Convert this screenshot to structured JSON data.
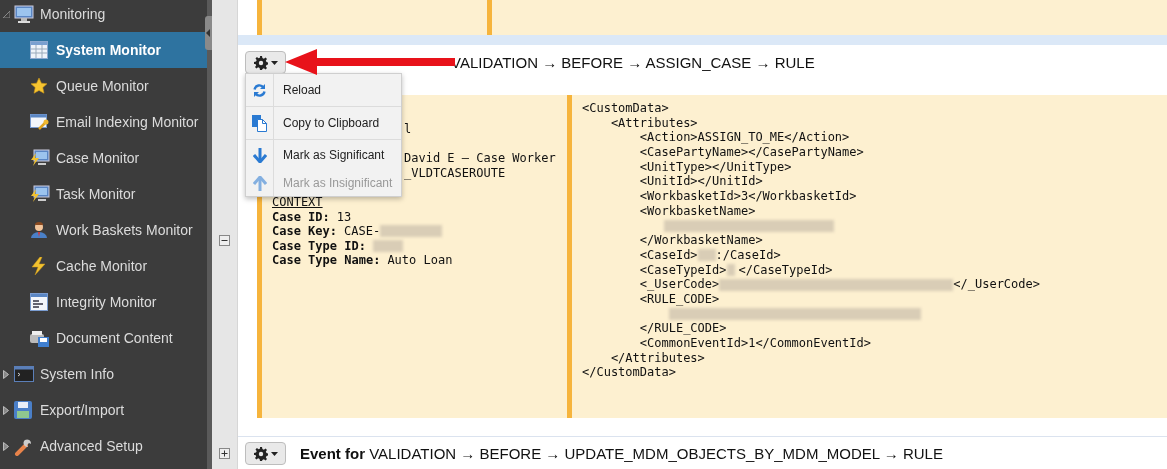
{
  "sidebar": {
    "items": [
      {
        "label": "Monitoring",
        "expanded": true,
        "selected": false,
        "children": [
          {
            "label": "System Monitor",
            "selected": true
          },
          {
            "label": "Queue Monitor",
            "selected": false
          },
          {
            "label": "Email Indexing Monitor",
            "selected": false
          },
          {
            "label": "Case Monitor",
            "selected": false
          },
          {
            "label": "Task Monitor",
            "selected": false
          },
          {
            "label": "Work Baskets Monitor",
            "selected": false
          },
          {
            "label": "Cache Monitor",
            "selected": false
          },
          {
            "label": "Integrity Monitor",
            "selected": false
          },
          {
            "label": "Document Content",
            "selected": false
          }
        ]
      },
      {
        "label": "System Info",
        "expanded": false,
        "selected": false
      },
      {
        "label": "Export/Import",
        "expanded": false,
        "selected": false
      },
      {
        "label": "Advanced Setup",
        "expanded": false,
        "selected": false
      }
    ]
  },
  "events": [
    {
      "kind": "partial"
    },
    {
      "kind": "full",
      "expanded": true,
      "title": "VALIDATION → BEFORE → ASSIGN_CASE → RULE",
      "menu": [
        {
          "label": "Reload",
          "disabled": false
        },
        {
          "label": "Copy to Clipboard",
          "disabled": false
        },
        {
          "label": "Mark as Significant",
          "disabled": false
        },
        {
          "label": "Mark as Insignificant",
          "disabled": true
        }
      ],
      "details": [
        {
          "kind": "fragment",
          "text": "l"
        },
        {
          "kind": "blank"
        },
        {
          "kind": "fragment",
          "text": "David E – Case Worker"
        },
        {
          "kind": "fragment",
          "text": "_VLDTCASEROUTE"
        },
        {
          "kind": "blank"
        },
        {
          "kind": "heading",
          "text": "CONTEXT"
        },
        {
          "kind": "field",
          "label": "Case ID:",
          "value": "13"
        },
        {
          "kind": "field",
          "label": "Case Key:",
          "value": "CASE-",
          "redacted": true
        },
        {
          "kind": "field",
          "label": "Case Type ID:",
          "redacted": true
        },
        {
          "kind": "field",
          "label": "Case Type Name:",
          "value": "Auto Loan"
        }
      ],
      "xml": [
        [
          {
            "text": "<CustomData>"
          }
        ],
        [
          {
            "text": "    <Attributes>"
          }
        ],
        [
          {
            "text": "        <Action>ASSIGN_TO_ME</Action>"
          }
        ],
        [
          {
            "text": "        <CasePartyName></CasePartyName>"
          }
        ],
        [
          {
            "text": "        <UnitType></UnitType>"
          }
        ],
        [
          {
            "text": "        <UnitId></UnitId>"
          }
        ],
        [
          {
            "text": "        <WorkbasketId>3</WorkbasketId>"
          }
        ],
        [
          {
            "text": "        <WorkbasketName>"
          }
        ],
        [
          {
            "kind": "redacted"
          }
        ],
        [
          {
            "text": "        </WorkbasketName>"
          }
        ],
        [
          {
            "text": "        <CaseId>"
          },
          {
            "kind": "redacted"
          },
          {
            "text": ":/CaseId>"
          }
        ],
        [
          {
            "text": "        <CaseTypeId>"
          },
          {
            "kind": "redacted"
          },
          {
            "text": "</CaseTypeId>"
          }
        ],
        [
          {
            "text": "        <_UserCode>"
          },
          {
            "kind": "redacted"
          },
          {
            "text": "</_UserCode>"
          }
        ],
        [
          {
            "text": "        <RULE_CODE>"
          }
        ],
        [
          {
            "kind": "redacted"
          }
        ],
        [
          {
            "text": "        </RULE_CODE>"
          }
        ],
        [
          {
            "text": "        <CommonEventId>1</CommonEventId>"
          }
        ],
        [
          {
            "text": "    </Attributes>"
          }
        ],
        [
          {
            "text": "</CustomData>"
          }
        ]
      ]
    },
    {
      "kind": "header",
      "expanded": false,
      "title": "**Event for** VALIDATION → BEFORE → UPDATE_MDM_OBJECTS_BY_MDM_MODEL → RULE"
    }
  ]
}
